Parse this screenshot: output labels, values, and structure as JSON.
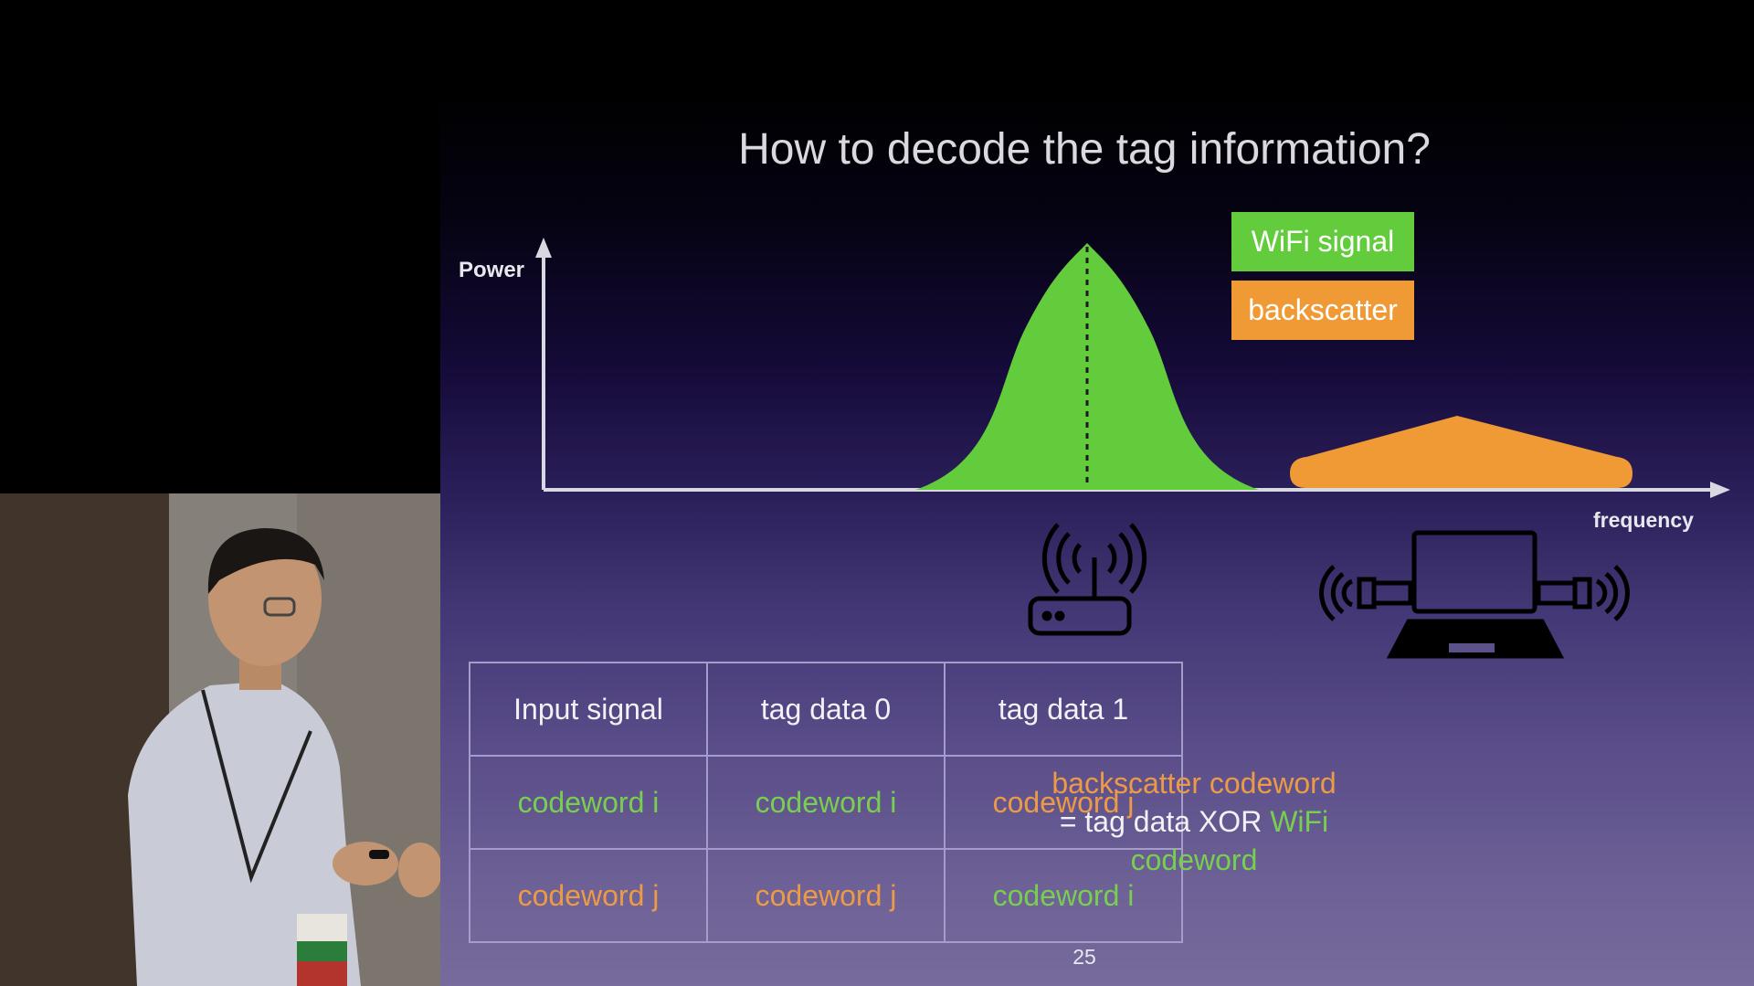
{
  "slide": {
    "title": "How to decode the tag information?",
    "page_number": "25"
  },
  "chart": {
    "y_label": "Power",
    "x_label": "frequency",
    "legend": [
      {
        "label": "WiFi signal",
        "color": "#62cc3c"
      },
      {
        "label": "backscatter",
        "color": "#f09a36"
      }
    ]
  },
  "icons": {
    "router": "wifi-router-icon",
    "laptop": "laptop-with-backscatter-tags-icon"
  },
  "table": {
    "headers": [
      "Input signal",
      "tag data 0",
      "tag data 1"
    ],
    "rows": [
      [
        "codeword i",
        "codeword i",
        "codeword j"
      ],
      [
        "codeword j",
        "codeword j",
        "codeword i"
      ]
    ],
    "colors": {
      "codeword i": "#78cf4f",
      "codeword j": "#ec9a45"
    }
  },
  "formula": {
    "line1": "backscatter codeword",
    "line2_prefix": "= tag data XOR ",
    "line2_highlight": "WiFi codeword"
  }
}
